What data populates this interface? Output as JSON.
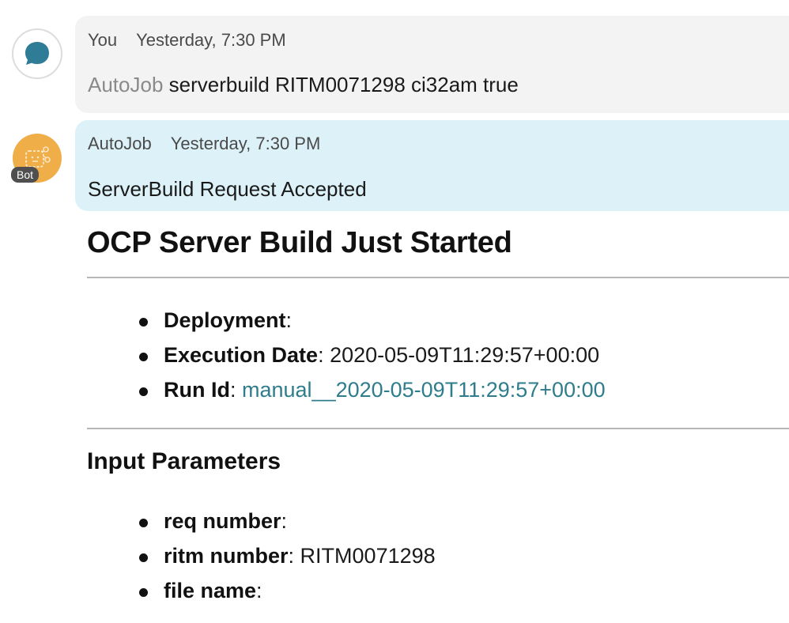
{
  "user_message": {
    "author": "You",
    "time": "Yesterday, 7:30 PM",
    "mention": "AutoJob",
    "text": " serverbuild RITM0071298 ci32am true"
  },
  "bot_message": {
    "author": "AutoJob",
    "time": "Yesterday, 7:30 PM",
    "text": "ServerBuild Request Accepted",
    "badge": "Bot"
  },
  "card": {
    "title": "OCP Server Build Just Started",
    "details": [
      {
        "key": "Deployment",
        "sep": ":",
        "value": ""
      },
      {
        "key": "Execution Date",
        "sep": ":",
        "value": " 2020-05-09T11:29:57+00:00"
      },
      {
        "key": "Run Id",
        "sep": ":",
        "value": " manual__2020-05-09T11:29:57+00:00"
      }
    ],
    "input_title": "Input Parameters",
    "inputs": [
      {
        "key": "req number",
        "sep": ":",
        "value": ""
      },
      {
        "key": "ritm number",
        "sep": ":",
        "value": " RITM0071298"
      },
      {
        "key": "file name",
        "sep": ":",
        "value": ""
      }
    ]
  },
  "colors": {
    "user_bubble": "#f3f3f3",
    "bot_bubble": "#dcf2f8",
    "bot_avatar": "#efae48",
    "user_avatar_icon": "#2e7c95",
    "link": "#2f7d8c"
  },
  "icons": {
    "user_avatar": "chat-bubble-icon",
    "bot_avatar": "bot-face-icon"
  }
}
